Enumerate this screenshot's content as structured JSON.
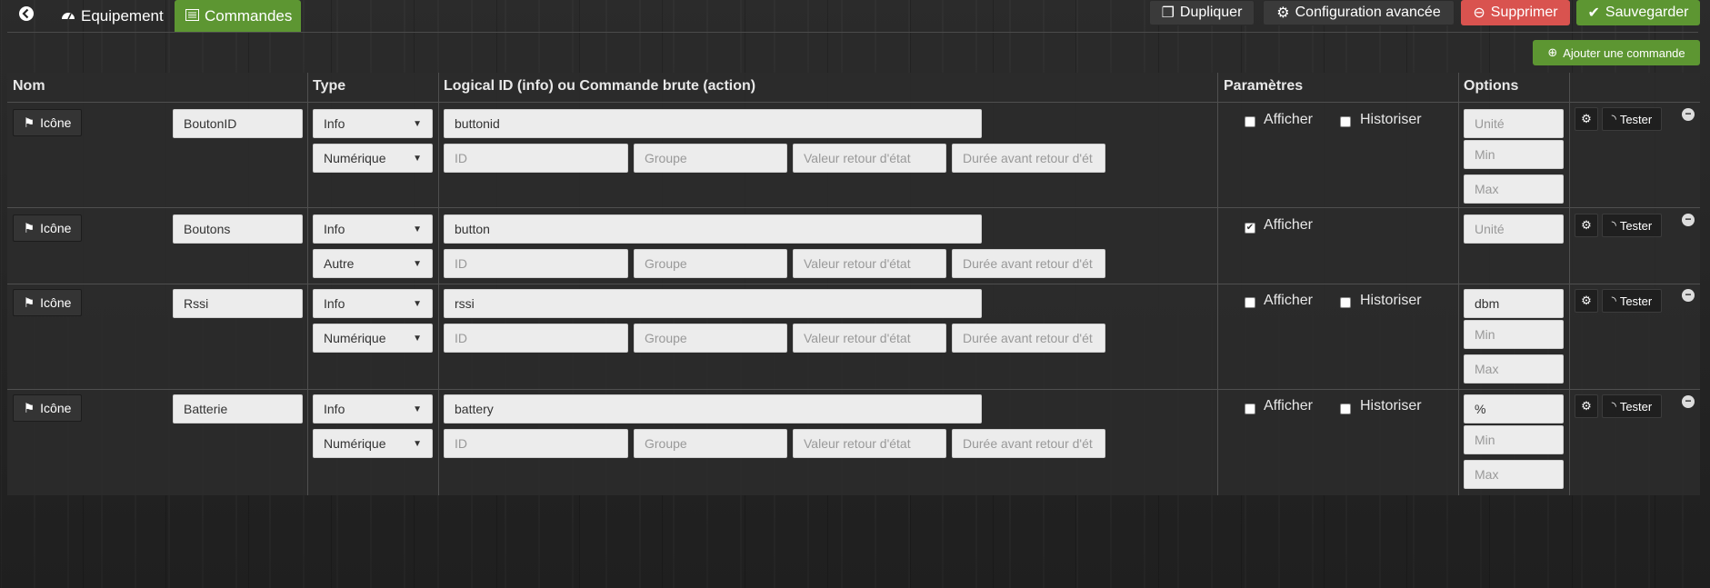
{
  "nav": {
    "tabs": [
      {
        "label": "Equipement",
        "icon": "dashboard-icon"
      },
      {
        "label": "Commandes",
        "icon": "list-alt-icon"
      }
    ]
  },
  "toolbar": {
    "duplicate_label": "Dupliquer",
    "config_label": "Configuration avancée",
    "delete_label": "Supprimer",
    "save_label": "Sauvegarder",
    "add_command_label": "Ajouter une commande"
  },
  "table": {
    "headers": {
      "nom": "Nom",
      "type": "Type",
      "logical": "Logical ID (info) ou Commande brute (action)",
      "params": "Paramètres",
      "options": "Options"
    },
    "icon_button_label": "Icône",
    "test_button_label": "Tester",
    "afficher_label": "Afficher",
    "historiser_label": "Historiser",
    "placeholders": {
      "id": "ID",
      "groupe": "Groupe",
      "valeur_retour": "Valeur retour d'état",
      "duree_retour": "Durée avant retour d'ét",
      "unite": "Unité",
      "min": "Min",
      "max": "Max"
    },
    "rows": [
      {
        "name": "BoutonID",
        "type": "Info",
        "subtype": "Numérique",
        "logical_id": "buttonid",
        "afficher": false,
        "historiser": false,
        "unit": ""
      },
      {
        "name": "Boutons",
        "type": "Info",
        "subtype": "Autre",
        "logical_id": "button",
        "afficher": true,
        "historiser": null,
        "unit": ""
      },
      {
        "name": "Rssi",
        "type": "Info",
        "subtype": "Numérique",
        "logical_id": "rssi",
        "afficher": false,
        "historiser": false,
        "unit": "dbm"
      },
      {
        "name": "Batterie",
        "type": "Info",
        "subtype": "Numérique",
        "logical_id": "battery",
        "afficher": false,
        "historiser": false,
        "unit": "%"
      }
    ]
  },
  "colors": {
    "accent_green": "#5d9632",
    "danger_red": "#d9534f"
  }
}
